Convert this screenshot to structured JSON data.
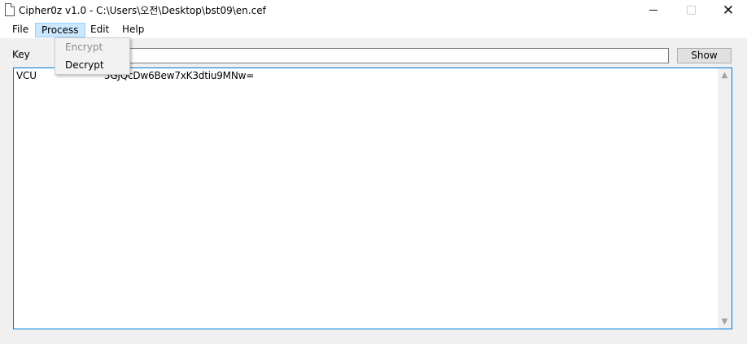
{
  "window": {
    "title": "Cipher0z v1.0 - C:\\Users\\오전\\Desktop\\bst09\\en.cef",
    "icon": "document-icon",
    "controls": {
      "minimize": "minimize-icon",
      "maximize": "maximize-icon",
      "close": "✕"
    }
  },
  "menubar": {
    "items": [
      {
        "label": "File"
      },
      {
        "label": "Process",
        "active": true
      },
      {
        "label": "Edit"
      },
      {
        "label": "Help"
      }
    ]
  },
  "process_menu": {
    "items": [
      {
        "label": "Encrypt",
        "enabled": false
      },
      {
        "label": "Decrypt",
        "enabled": true
      }
    ]
  },
  "key": {
    "label": "Key",
    "value": "",
    "show_button": "Show"
  },
  "content": {
    "visible_text": "VCU                       5GJQcDw6Bew7xK3dtiu9MNw="
  },
  "scrollbar": {
    "up": "▲",
    "down": "▼"
  },
  "colors": {
    "active_menu_bg": "#cce8ff",
    "active_menu_border": "#99d1ff",
    "textarea_border": "#0078d7"
  }
}
